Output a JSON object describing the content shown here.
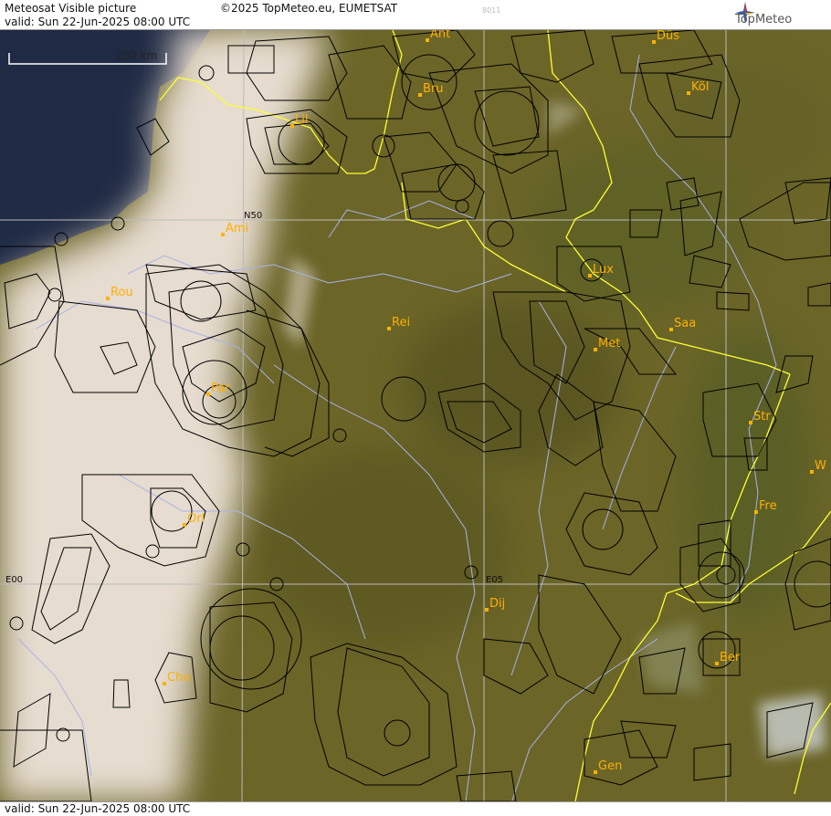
{
  "header": {
    "title": "Meteosat Visible picture",
    "valid": "valid:  Sun  22-Jun-2025  08:00 UTC",
    "copyright": "©2025 TopMeteo.eu, EUMETSAT",
    "code": "8011",
    "brand": "TopMeteo"
  },
  "footer": {
    "valid": "valid:  Sun  22-Jun-2025  08:00 UTC"
  },
  "map": {
    "scale_label": "200 km",
    "grid_labels": {
      "n50": "N50",
      "e00": "E00",
      "e05": "E05"
    },
    "cities": [
      {
        "label": "Ant"
      },
      {
        "label": "Düs"
      },
      {
        "label": "Bru"
      },
      {
        "label": "Köl"
      },
      {
        "label": "Lil"
      },
      {
        "label": "Ami"
      },
      {
        "label": "Lux"
      },
      {
        "label": "Rou"
      },
      {
        "label": "Rei"
      },
      {
        "label": "Saa"
      },
      {
        "label": "Met"
      },
      {
        "label": "Par"
      },
      {
        "label": "Str"
      },
      {
        "label": "W"
      },
      {
        "label": "Fre"
      },
      {
        "label": "Orl"
      },
      {
        "label": "Dij"
      },
      {
        "label": "Ber"
      },
      {
        "label": "Cha"
      },
      {
        "label": "Gen"
      }
    ],
    "colors": {
      "land": "#6b6528",
      "sea": "#1f2a44",
      "cloud": "#e6dccf",
      "border": "#ffff33",
      "river": "#a8b2e8",
      "airspace": "#000000",
      "city_label": "#ffb000",
      "grid": "#bbbbbb"
    }
  }
}
